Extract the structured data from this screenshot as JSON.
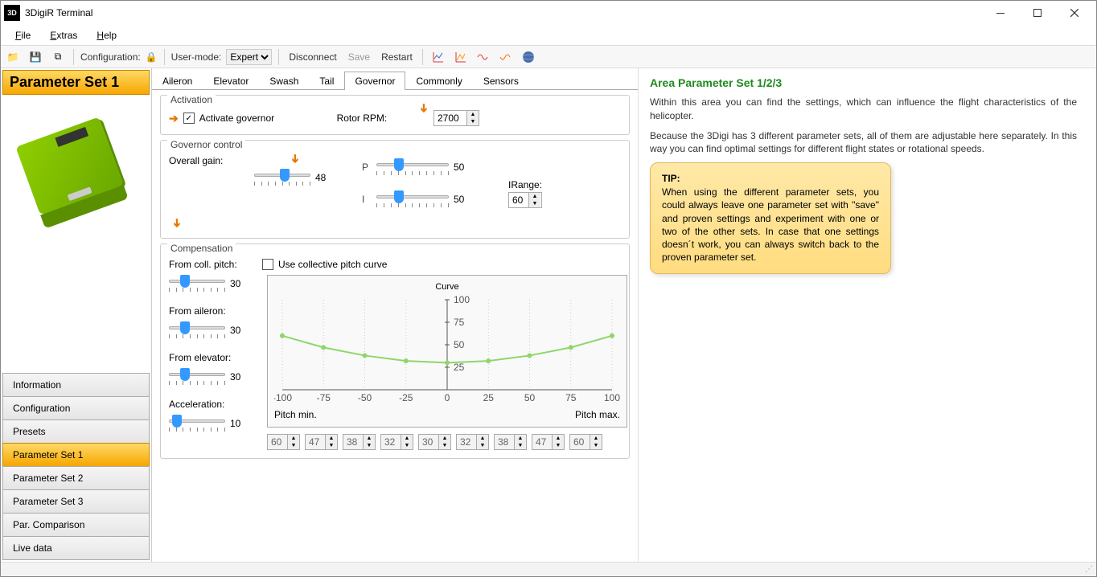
{
  "window": {
    "title": "3DigiR Terminal"
  },
  "menu": {
    "file": "File",
    "extras": "Extras",
    "help": "Help"
  },
  "toolbar": {
    "configuration": "Configuration:",
    "usermode": "User-mode:",
    "usermode_value": "Expert",
    "disconnect": "Disconnect",
    "save": "Save",
    "restart": "Restart"
  },
  "heading": "Parameter Set 1",
  "nav": {
    "information": "Information",
    "configuration": "Configuration",
    "presets": "Presets",
    "ps1": "Parameter Set 1",
    "ps2": "Parameter Set 2",
    "ps3": "Parameter Set 3",
    "parcomp": "Par. Comparison",
    "livedata": "Live data"
  },
  "tabs": {
    "aileron": "Aileron",
    "elevator": "Elevator",
    "swash": "Swash",
    "tail": "Tail",
    "governor": "Governor",
    "commonly": "Commonly",
    "sensors": "Sensors"
  },
  "activation": {
    "legend": "Activation",
    "checkbox": "Activate governor",
    "rotor_label": "Rotor RPM:",
    "rotor_value": "2700"
  },
  "govcontrol": {
    "legend": "Governor control",
    "overall_gain": "Overall gain:",
    "overall_gain_val": "48",
    "p": "P",
    "p_val": "50",
    "i": "I",
    "i_val": "50",
    "irange": "IRange:",
    "irange_val": "60"
  },
  "compensation": {
    "legend": "Compensation",
    "coll": "From coll. pitch:",
    "coll_val": "30",
    "use_curve": "Use collective pitch curve",
    "ail": "From aileron:",
    "ail_val": "30",
    "ele": "From elevator:",
    "ele_val": "30",
    "accel": "Acceleration:",
    "accel_val": "10",
    "curve_title": "Curve",
    "pitchmin": "Pitch min.",
    "pitchmax": "Pitch max.",
    "xticks": [
      "-100",
      "-75",
      "-50",
      "-25",
      "0",
      "25",
      "50",
      "75",
      "100"
    ],
    "yticks": [
      "100",
      "75",
      "50",
      "25"
    ],
    "vals": [
      "60",
      "47",
      "38",
      "32",
      "30",
      "32",
      "38",
      "47",
      "60"
    ]
  },
  "chart_data": {
    "type": "line",
    "title": "Curve",
    "xlabel": "",
    "ylabel": "",
    "xlim": [
      -100,
      100
    ],
    "ylim": [
      0,
      100
    ],
    "x": [
      -100,
      -75,
      -50,
      -25,
      0,
      25,
      50,
      75,
      100
    ],
    "values": [
      60,
      47,
      38,
      32,
      30,
      32,
      38,
      47,
      60
    ]
  },
  "help": {
    "title": "Area Parameter Set 1/2/3",
    "p1": "Within this area you can find the settings, which can influence the flight characteristics of the helicopter.",
    "p2": "Because the 3Digi has 3 different parameter sets, all of them are adjustable here separately. In this way you can find optimal settings for different flight states or rotational speeds.",
    "tip_h": "TIP:",
    "tip_b": "When using the different parameter sets, you could always leave one parameter set with \"save\" and proven settings and experiment with one or two of the other sets. In case that one settings doesn´t work, you can always switch back to the proven parameter set."
  }
}
